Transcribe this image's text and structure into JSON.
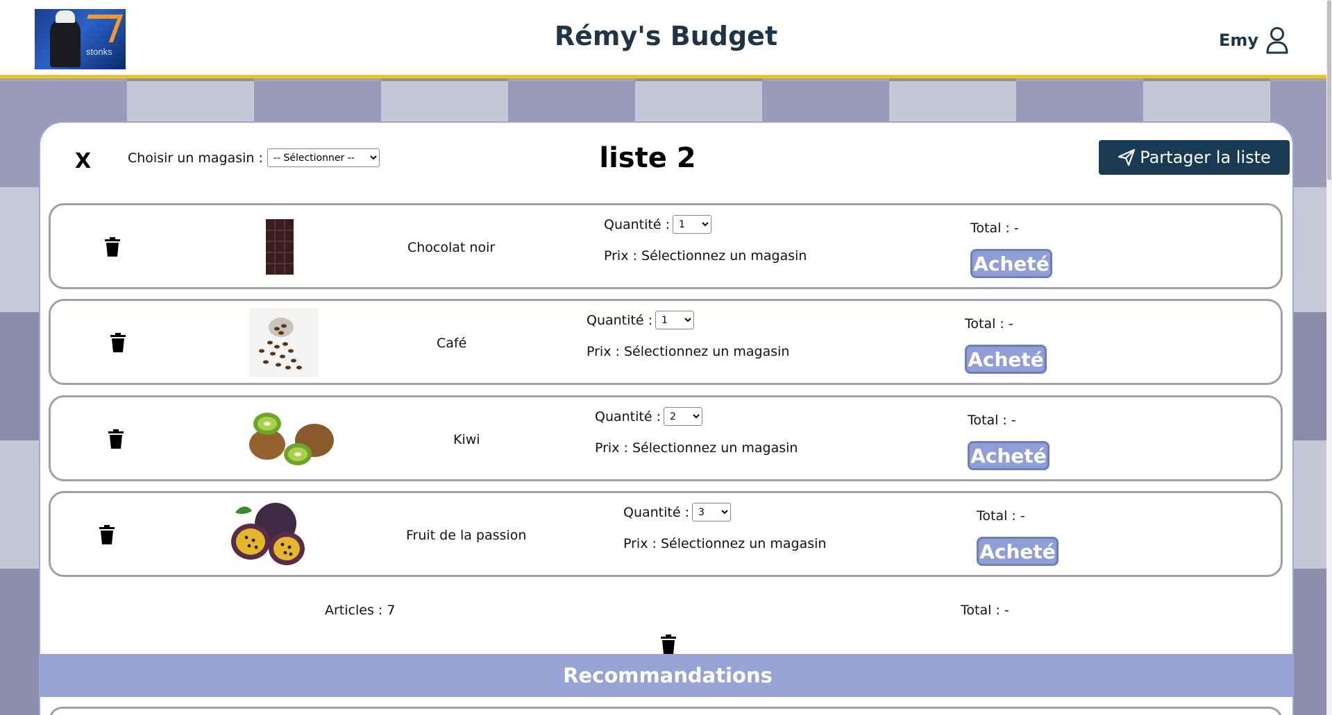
{
  "header": {
    "app_title": "Rémy's Budget",
    "logo_text": "stonks",
    "user_name": "Emy"
  },
  "list": {
    "title": "liste 2",
    "close_label": "X",
    "store_label": "Choisir un magasin :",
    "store_selected": "-- Sélectionner --",
    "share_label": "Partager la liste"
  },
  "items": [
    {
      "name": "Chocolat noir",
      "qty_label": "Quantité :",
      "qty": "1",
      "price": "Prix : Sélectionnez un magasin",
      "total": "Total : -",
      "bought_label": "Acheté"
    },
    {
      "name": "Café",
      "qty_label": "Quantité :",
      "qty": "1",
      "price": "Prix : Sélectionnez un magasin",
      "total": "Total : -",
      "bought_label": "Acheté"
    },
    {
      "name": "Kiwi",
      "qty_label": "Quantité :",
      "qty": "2",
      "price": "Prix : Sélectionnez un magasin",
      "total": "Total : -",
      "bought_label": "Acheté"
    },
    {
      "name": "Fruit de la passion",
      "qty_label": "Quantité :",
      "qty": "3",
      "price": "Prix : Sélectionnez un magasin",
      "total": "Total : -",
      "bought_label": "Acheté"
    }
  ],
  "summary": {
    "articles": "Articles : 7",
    "total": "Total : -"
  },
  "recommendations": {
    "title": "Recommandations"
  },
  "colors": {
    "accent": "#f0c419",
    "primary_dark": "#183a52",
    "bought_button": "#8f9ed6",
    "reco_banner": "#97a3d4"
  }
}
